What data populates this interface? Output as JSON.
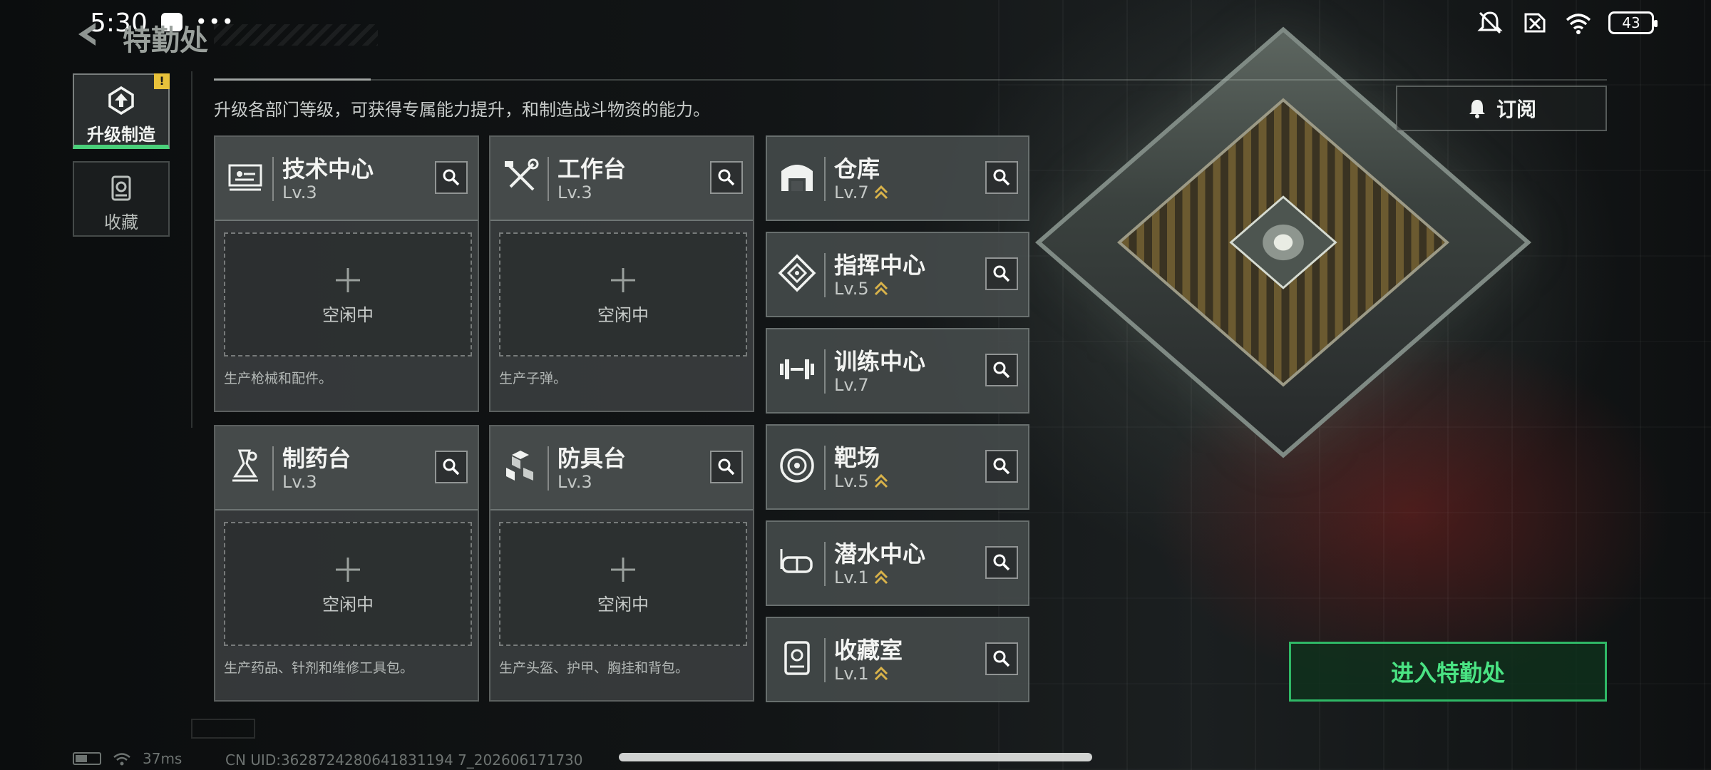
{
  "status_bar": {
    "time": "5:30",
    "dots": "•••",
    "battery": "43"
  },
  "header": {
    "title": "特勤处"
  },
  "sidebar": {
    "items": [
      {
        "label": "升级制造",
        "badge": "!",
        "icon": "upgrade-icon",
        "active": true
      },
      {
        "label": "收藏",
        "icon": "collection-icon",
        "active": false
      }
    ]
  },
  "subtitle": "升级各部门等级，可获得专属能力提升，和制造战斗物资的能力。",
  "production_cards": [
    {
      "name": "技术中心",
      "level": "Lv.3",
      "icon": "tech-center-icon",
      "status": "空闲中",
      "desc": "生产枪械和配件。"
    },
    {
      "name": "工作台",
      "level": "Lv.3",
      "icon": "workbench-icon",
      "status": "空闲中",
      "desc": "生产子弹。"
    },
    {
      "name": "制药台",
      "level": "Lv.3",
      "icon": "pharmacy-icon",
      "status": "空闲中",
      "desc": "生产药品、针剂和维修工具包。"
    },
    {
      "name": "防具台",
      "level": "Lv.3",
      "icon": "armor-bench-icon",
      "status": "空闲中",
      "desc": "生产头盔、护甲、胸挂和背包。"
    }
  ],
  "facilities": [
    {
      "name": "仓库",
      "level": "Lv.7",
      "upgradable": true,
      "icon": "warehouse-icon"
    },
    {
      "name": "指挥中心",
      "level": "Lv.5",
      "upgradable": true,
      "icon": "command-center-icon"
    },
    {
      "name": "训练中心",
      "level": "Lv.7",
      "upgradable": false,
      "icon": "training-center-icon"
    },
    {
      "name": "靶场",
      "level": "Lv.5",
      "upgradable": true,
      "icon": "shooting-range-icon"
    },
    {
      "name": "潜水中心",
      "level": "Lv.1",
      "upgradable": true,
      "icon": "diving-center-icon"
    },
    {
      "name": "收藏室",
      "level": "Lv.1",
      "upgradable": true,
      "icon": "collection-room-icon"
    }
  ],
  "buttons": {
    "subscribe": "订阅",
    "enter": "进入特勤处"
  },
  "footer": {
    "ping": "37ms",
    "uid": "CN UID:3628724280641831194 7_202606171730"
  },
  "colors": {
    "accent": "#4ae383",
    "badge": "#e8c23b",
    "upgrade_arrow": "#d8b24a"
  }
}
